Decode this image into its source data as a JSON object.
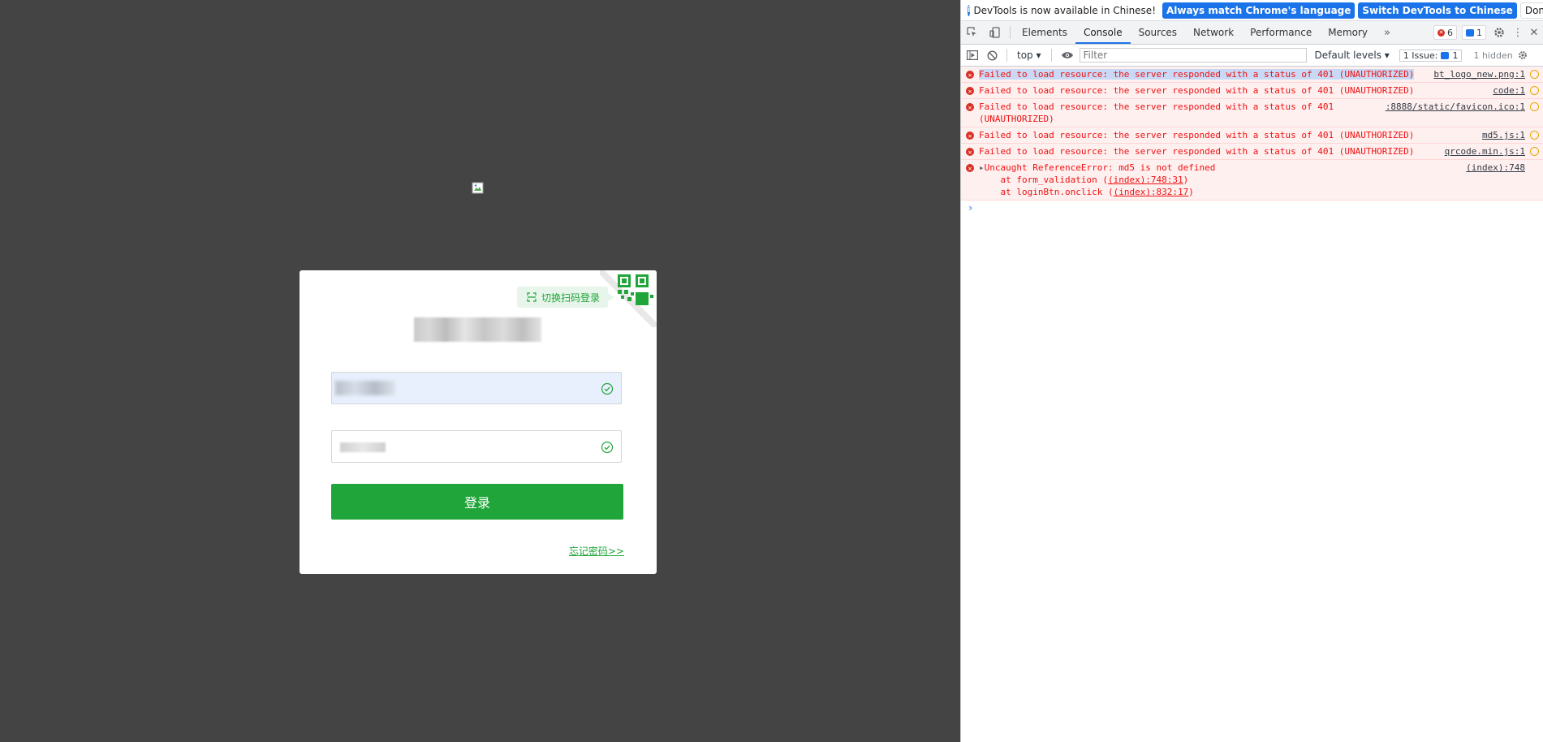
{
  "login": {
    "qr_switch_label": "切换扫码登录",
    "login_button": "登录",
    "forgot_link": "忘记密码>>"
  },
  "devtools": {
    "infobar": {
      "text": "DevTools is now available in Chinese!",
      "match_button": "Always match Chrome's language",
      "switch_button": "Switch DevTools to Chinese",
      "dismiss_button": "Don't show again"
    },
    "tabs": [
      "Elements",
      "Console",
      "Sources",
      "Network",
      "Performance",
      "Memory"
    ],
    "active_tab": "Console",
    "error_count": "6",
    "message_count": "1",
    "toolbar": {
      "context": "top",
      "filter_placeholder": "Filter",
      "levels": "Default levels",
      "issues": "1 Issue:",
      "issues_count": "1",
      "hidden": "1 hidden"
    },
    "logs": [
      {
        "message": "Failed to load resource: the server responded with a status of 401 (UNAUTHORIZED)",
        "source": "bt_logo_new.png:1"
      },
      {
        "message": "Failed to load resource: the server responded with a status of 401 (UNAUTHORIZED)",
        "source": "code:1"
      },
      {
        "message": "Failed to load resource: the server responded with a status of 401\n(UNAUTHORIZED)",
        "source": ":8888/static/favicon.ico:1"
      },
      {
        "message": "Failed to load resource: the server responded with a status of 401 (UNAUTHORIZED)",
        "source": "md5.js:1"
      },
      {
        "message": "Failed to load resource: the server responded with a status of 401 (UNAUTHORIZED)",
        "source": "qrcode.min.js:1"
      }
    ],
    "exception": {
      "message": "Uncaught ReferenceError: md5 is not defined",
      "frame1_prefix": "    at form_validation (",
      "frame1_link": "(index):748:31",
      "frame1_suffix": ")",
      "frame2_prefix": "    at loginBtn.onclick (",
      "frame2_link": "(index):832:17",
      "frame2_suffix": ")",
      "source": "(index):748"
    },
    "prompt": "›"
  },
  "colors": {
    "brand_green": "#20a53a",
    "page_background": "#444444",
    "error_red": "#e11111",
    "devtools_blue": "#1a73e8"
  }
}
